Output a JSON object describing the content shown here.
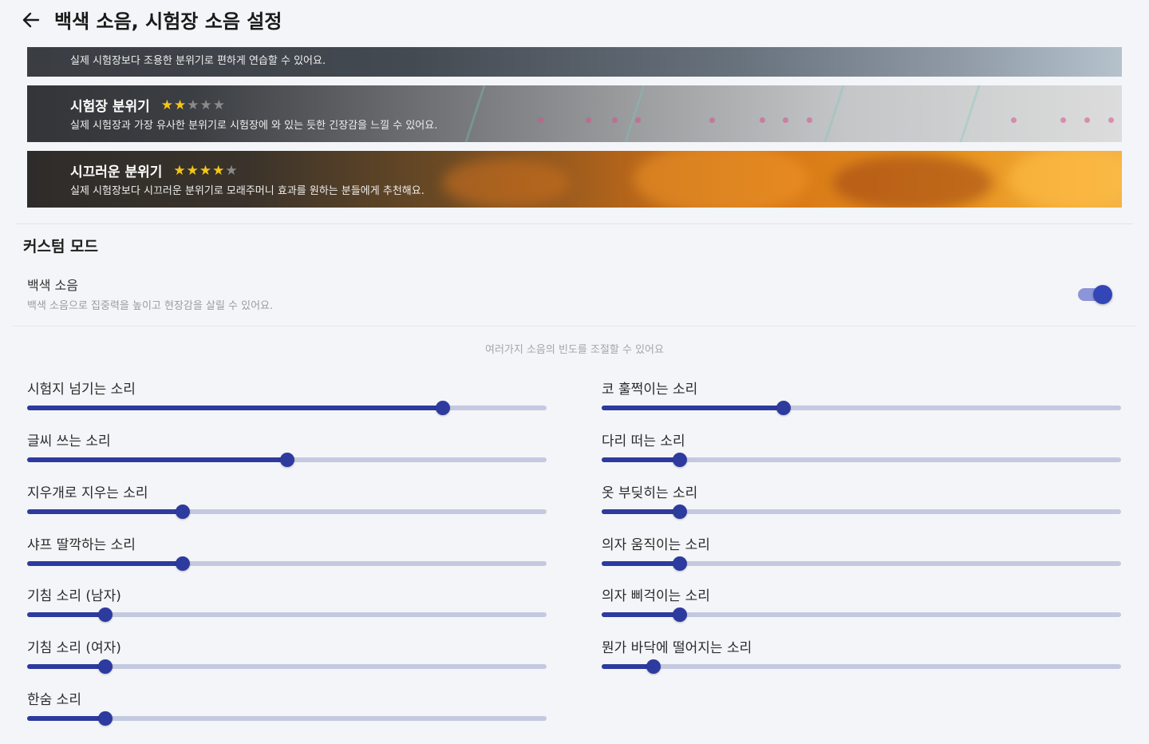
{
  "header": {
    "title": "백색 소음, 시험장 소음 설정"
  },
  "banners": [
    {
      "description": "실제 시험장보다 조용한 분위기로 편하게 연습할 수 있어요."
    },
    {
      "title": "시험장 분위기",
      "stars": "★★★★★",
      "rating": 2,
      "max_rating": 5,
      "description": "실제 시험장과 가장 유사한 분위기로 시험장에 와 있는 듯한 긴장감을 느낄 수 있어요."
    },
    {
      "title": "시끄러운 분위기",
      "stars": "★★★★★",
      "rating": 4,
      "max_rating": 5,
      "description": "실제 시험장보다 시끄러운 분위기로 모래주머니 효과를 원하는 분들에게 추천해요."
    }
  ],
  "custom_mode": {
    "title": "커스텀 모드",
    "white_noise": {
      "label": "백색 소음",
      "description": "백색 소음으로 집중력을 높이고 현장감을 살릴 수 있어요.",
      "enabled": true
    },
    "helper_text": "여러가지 소음의 빈도를 조절할 수 있어요"
  },
  "sliders_left": [
    {
      "label": "시험지 넘기는 소리",
      "value": 0.8
    },
    {
      "label": "글씨 쓰는 소리",
      "value": 0.5
    },
    {
      "label": "지우개로 지우는 소리",
      "value": 0.3
    },
    {
      "label": "샤프 딸깍하는 소리",
      "value": 0.3
    },
    {
      "label": "기침 소리 (남자)",
      "value": 0.15
    },
    {
      "label": "기침 소리 (여자)",
      "value": 0.15
    },
    {
      "label": "한숨 소리",
      "value": 0.15
    }
  ],
  "sliders_right": [
    {
      "label": "코 훌쩍이는 소리",
      "value": 0.35
    },
    {
      "label": "다리 떠는 소리",
      "value": 0.15
    },
    {
      "label": "옷 부딪히는 소리",
      "value": 0.15
    },
    {
      "label": "의자 움직이는 소리",
      "value": 0.15
    },
    {
      "label": "의자 삐걱이는 소리",
      "value": 0.15
    },
    {
      "label": "뭔가 바닥에 떨어지는 소리",
      "value": 0.1
    }
  ],
  "colors": {
    "accent": "#2d3a9e",
    "track": "#c5c9e0",
    "star_on": "#f5c518",
    "star_off": "#8a8a8a"
  }
}
